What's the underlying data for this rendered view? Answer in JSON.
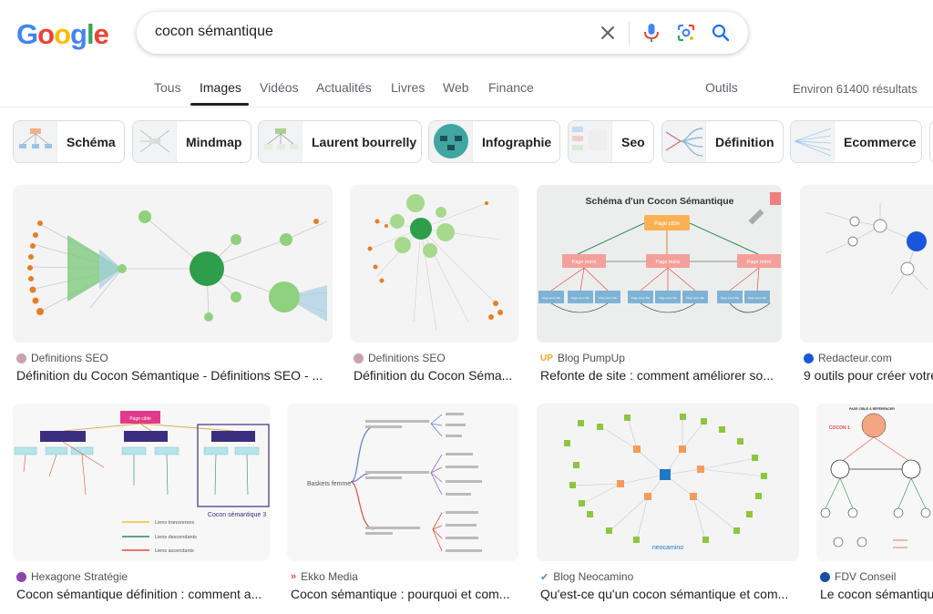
{
  "logo": {
    "letters": [
      "G",
      "o",
      "o",
      "g",
      "l",
      "e"
    ],
    "colors": [
      "#4285F4",
      "#EA4335",
      "#FBBC05",
      "#4285F4",
      "#34A853",
      "#EA4335"
    ]
  },
  "search": {
    "query": "cocon sémantique"
  },
  "icons": {
    "clear": "close-icon",
    "voice": "microphone-icon",
    "lens": "camera-lens-icon",
    "search": "search-icon"
  },
  "tabs": [
    "Tous",
    "Images",
    "Vidéos",
    "Actualités",
    "Livres",
    "Web",
    "Finance"
  ],
  "tools_label": "Outils",
  "results_count": "Environ 61400 résultats",
  "chips": [
    "Schéma",
    "Mindmap",
    "Laurent bourrelly",
    "Infographie",
    "Seo",
    "Définition",
    "Ecommerce"
  ],
  "results": [
    {
      "source": "Definitions SEO",
      "title": "Définition du Cocon Sémantique - Définitions SEO - ..."
    },
    {
      "source": "Definitions SEO",
      "title": "Définition du Cocon Séma..."
    },
    {
      "source": "Blog PumpUp",
      "title": "Refonte de site : comment améliorer so...",
      "image_text": {
        "heading": "Schéma d'un Cocon Sémantique",
        "top": "Page cible",
        "mid": "Page mère",
        "leaf": "Page sœur fille"
      }
    },
    {
      "source": "Redacteur.com",
      "title": "9 outils pour créer votre"
    },
    {
      "source": "Hexagone Stratégie",
      "title": "Cocon sémantique définition : comment a...",
      "image_text": {
        "root": "Page cible",
        "caption": "Cocon sémantique 3",
        "legend": [
          "Liens transverses",
          "Liens descendants",
          "Liens ascendants"
        ]
      }
    },
    {
      "source": "Ekko Media",
      "title": "Cocon sémantique : pourquoi et com...",
      "image_text": {
        "root": "Baskets femme"
      }
    },
    {
      "source": "Blog Neocamino",
      "title": "Qu'est-ce qu'un cocon sémantique et com...",
      "image_text": {
        "brand": "neocamino"
      }
    },
    {
      "source": "FDV Conseil",
      "title": "Le cocon sémantiqu",
      "image_text": {
        "heading": "PAGE CIBLE À RÉFÉRENCER",
        "label": "COCON 1"
      }
    }
  ]
}
